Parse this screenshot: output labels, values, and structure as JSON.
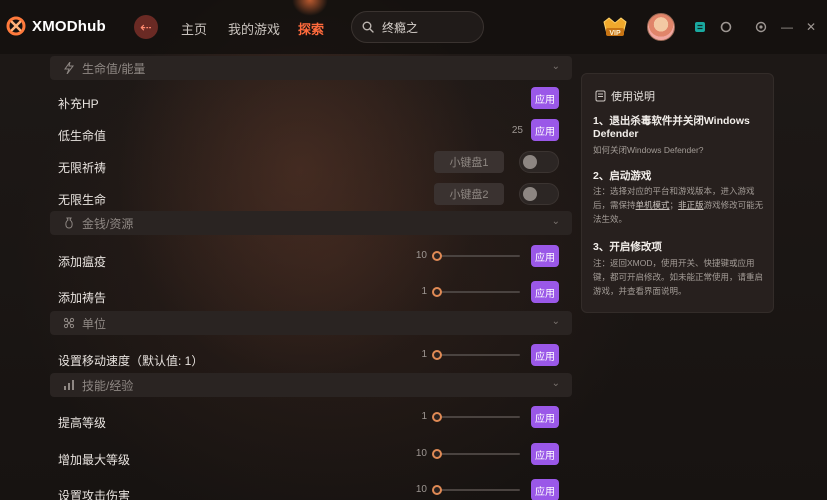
{
  "app": {
    "name": "XMODhub"
  },
  "nav": {
    "items": [
      {
        "label": "主页",
        "active": false
      },
      {
        "label": "我的游戏",
        "active": false
      },
      {
        "label": "探索",
        "active": true
      }
    ]
  },
  "search": {
    "value": "终瘾之"
  },
  "icons": {
    "back": "back-arrow-icon",
    "search": "search-icon",
    "vip": "vip-badge-icon",
    "minimize": "minimize-icon",
    "close": "close-icon"
  },
  "colors": {
    "accent": "#ff6a3c",
    "apply": "#9a58e8"
  },
  "sections": [
    {
      "title": "生命值/能量"
    },
    {
      "title": "金钱/资源"
    },
    {
      "title": "单位"
    },
    {
      "title": "技能/经验"
    }
  ],
  "rows": {
    "hp_refill": {
      "label": "补充HP",
      "apply": "应用"
    },
    "low_hp": {
      "label": "低生命值",
      "value": "25",
      "apply": "应用"
    },
    "inf_prayer": {
      "label": "无限祈祷",
      "hotkey": "小键盘1",
      "enabled": false
    },
    "inf_life": {
      "label": "无限生命",
      "hotkey": "小键盘2",
      "enabled": false
    },
    "add_plague": {
      "label": "添加瘟疫",
      "value": "10",
      "apply": "应用"
    },
    "add_prayer": {
      "label": "添加祷告",
      "value": "1",
      "apply": "应用"
    },
    "move_speed": {
      "label": "设置移动速度（默认值: 1）",
      "value": "1",
      "apply": "应用"
    },
    "level_up": {
      "label": "提高等级",
      "value": "1",
      "apply": "应用"
    },
    "max_level": {
      "label": "增加最大等级",
      "value": "10",
      "apply": "应用"
    },
    "attack_dmg": {
      "label": "设置攻击伤害",
      "value": "10",
      "apply": "应用"
    }
  },
  "guide": {
    "title": "使用说明",
    "step1_title": "1、退出杀毒软件并关闭Windows Defender",
    "step1_link": "如何关闭Windows Defender?",
    "step2_title": "2、启动游戏",
    "step2_text_a": "注：选择对应的平台和游戏版本，进入游戏后，需保持",
    "step2_link_a": "单机模式",
    "step2_sep": "；",
    "step2_link_b": "非正版",
    "step2_text_b": "游戏修改可能无法生效。",
    "step3_title": "3、开启修改项",
    "step3_text": "注：返回XMOD，使用开关、快捷键或应用键，都可开启修改。如未能正常使用，请重启游戏，并查看界面说明。"
  }
}
